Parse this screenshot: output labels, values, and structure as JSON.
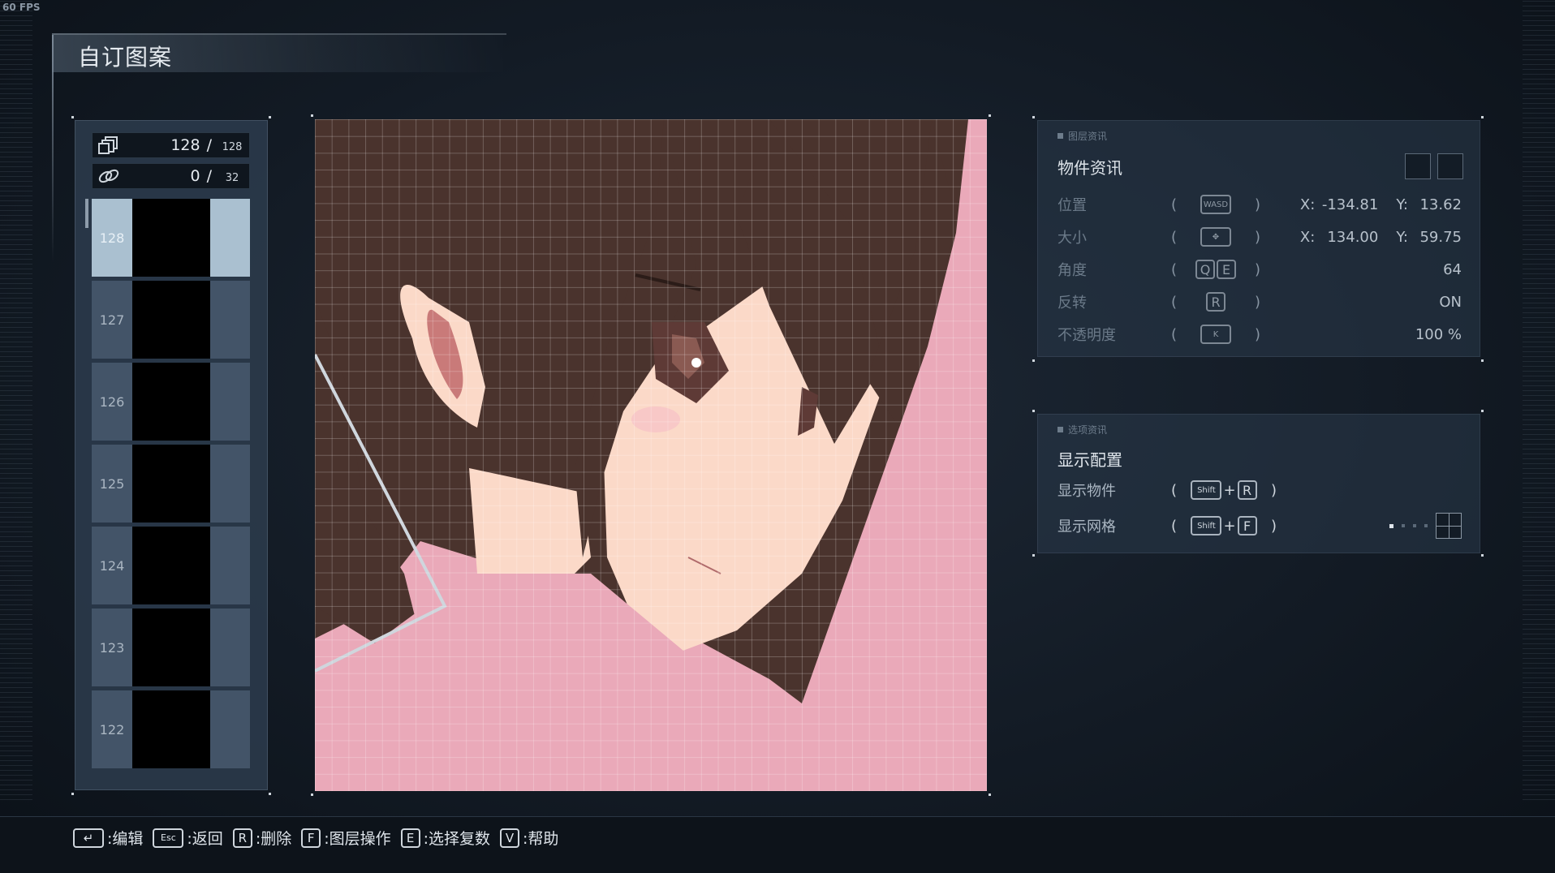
{
  "fps": "60 FPS",
  "title": "自订图案",
  "layer_panel": {
    "layer_count": "128",
    "layer_max": "128",
    "group_count": "0",
    "group_max": "32",
    "layers": [
      {
        "num": "128",
        "selected": true
      },
      {
        "num": "127",
        "selected": false
      },
      {
        "num": "126",
        "selected": false
      },
      {
        "num": "125",
        "selected": false
      },
      {
        "num": "124",
        "selected": false
      },
      {
        "num": "123",
        "selected": false
      },
      {
        "num": "122",
        "selected": false
      }
    ]
  },
  "object_info": {
    "tag": "图层资讯",
    "title": "物件资讯",
    "position": {
      "label": "位置",
      "key": "WASD",
      "x_label": "X:",
      "x": "-134.81",
      "y_label": "Y:",
      "y": "13.62"
    },
    "size": {
      "label": "大小",
      "x_label": "X:",
      "x": "134.00",
      "y_label": "Y:",
      "y": "59.75"
    },
    "angle": {
      "label": "角度",
      "keys": [
        "Q",
        "E"
      ],
      "value": "64"
    },
    "flip": {
      "label": "反转",
      "key": "R",
      "value": "ON"
    },
    "opacity": {
      "label": "不透明度",
      "key": "K",
      "value": "100 %"
    }
  },
  "option_info": {
    "tag": "选项资讯",
    "title": "显示配置",
    "show_objects": {
      "label": "显示物件",
      "mod": "Shift",
      "key": "R"
    },
    "show_grid": {
      "label": "显示网格",
      "mod": "Shift",
      "key": "F"
    }
  },
  "footer": {
    "edit": ":编辑",
    "back_key": "Esc",
    "back": ":返回",
    "delete_key": "R",
    "delete": ":删除",
    "layer_key": "F",
    "layer_ops": ":图层操作",
    "select_key": "E",
    "select_multi": ":选择复数",
    "help_key": "V",
    "help": ":帮助"
  },
  "colors": {
    "canvas_bg": "#eaa9b9",
    "hair": "#4a332d",
    "skin": "#fbd9c8",
    "selected_layer": "#aac0d0"
  }
}
